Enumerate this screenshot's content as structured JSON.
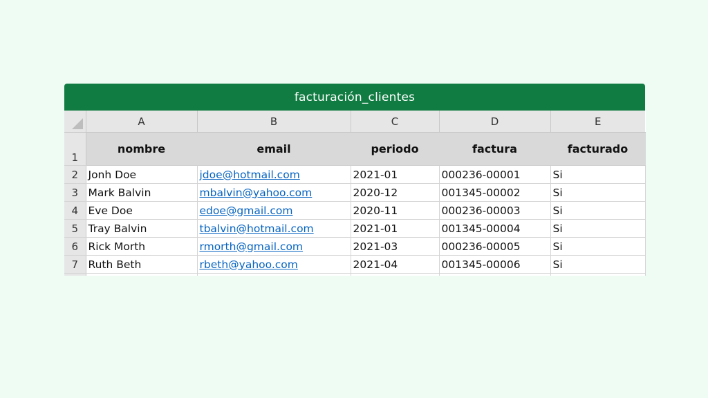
{
  "title": "facturación_clientes",
  "columns": [
    "A",
    "B",
    "C",
    "D",
    "E"
  ],
  "headers": {
    "row_number": "1",
    "nombre": "nombre",
    "email": "email",
    "periodo": "periodo",
    "factura": "factura",
    "facturado": "facturado"
  },
  "rows": [
    {
      "num": "2",
      "nombre": "Jonh Doe",
      "email": "jdoe@hotmail.com",
      "periodo": "2021-01",
      "factura": "000236-00001",
      "facturado": "Si"
    },
    {
      "num": "3",
      "nombre": "Mark Balvin",
      "email": "mbalvin@yahoo.com",
      "periodo": "2020-12",
      "factura": "001345-00002",
      "facturado": "Si"
    },
    {
      "num": "4",
      "nombre": "Eve Doe",
      "email": "edoe@gmail.com",
      "periodo": "2020-11",
      "factura": "000236-00003",
      "facturado": "Si"
    },
    {
      "num": "5",
      "nombre": "Tray Balvin",
      "email": "tbalvin@hotmail.com",
      "periodo": "2021-01",
      "factura": "001345-00004",
      "facturado": "Si"
    },
    {
      "num": "6",
      "nombre": "Rick Morth",
      "email": "rmorth@gmail.com",
      "periodo": "2021-03",
      "factura": "000236-00005",
      "facturado": "Si"
    },
    {
      "num": "7",
      "nombre": "Ruth Beth",
      "email": "rbeth@yahoo.com",
      "periodo": "2021-04",
      "factura": "001345-00006",
      "facturado": "Si"
    }
  ],
  "colors": {
    "title_bar": "#107c41",
    "background": "#effcf4",
    "header_fill": "#d9d9d9",
    "link": "#0563c1"
  }
}
